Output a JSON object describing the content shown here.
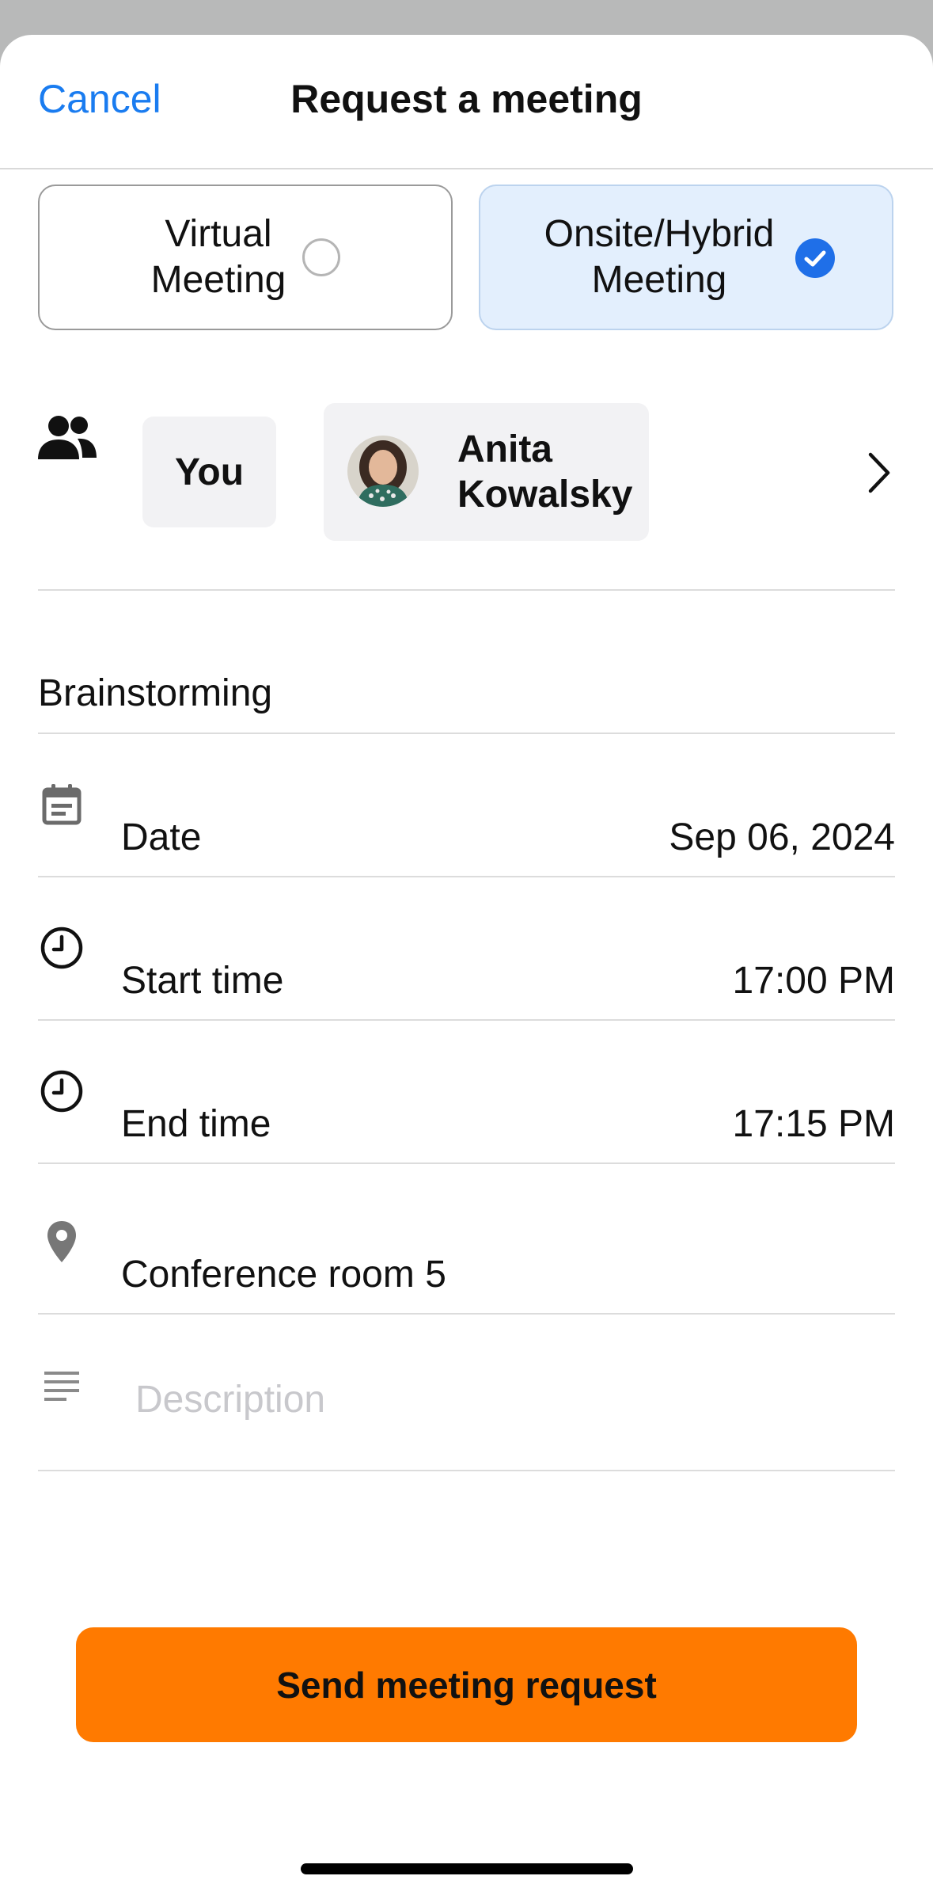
{
  "header": {
    "cancel_label": "Cancel",
    "title": "Request a meeting"
  },
  "meeting_type": {
    "virtual_label": "Virtual\nMeeting",
    "onsite_label": "Onsite/Hybrid\nMeeting",
    "selected": "onsite"
  },
  "participants": {
    "you_label": "You",
    "person_name": "Anita Kowalsky",
    "icon": "people-icon"
  },
  "form": {
    "meeting_title": "Brainstorming",
    "date_label": "Date",
    "date_value": "Sep 06, 2024",
    "start_label": "Start time",
    "start_value": "17:00 PM",
    "end_label": "End time",
    "end_value": "17:15 PM",
    "location_value": "Conference room 5",
    "description_placeholder": "Description"
  },
  "actions": {
    "send_label": "Send meeting request"
  },
  "colors": {
    "accent_blue": "#1a7cf0",
    "selected_bg": "#e3effd",
    "check_blue": "#1f6fe8",
    "primary_button": "#ff7a00"
  }
}
